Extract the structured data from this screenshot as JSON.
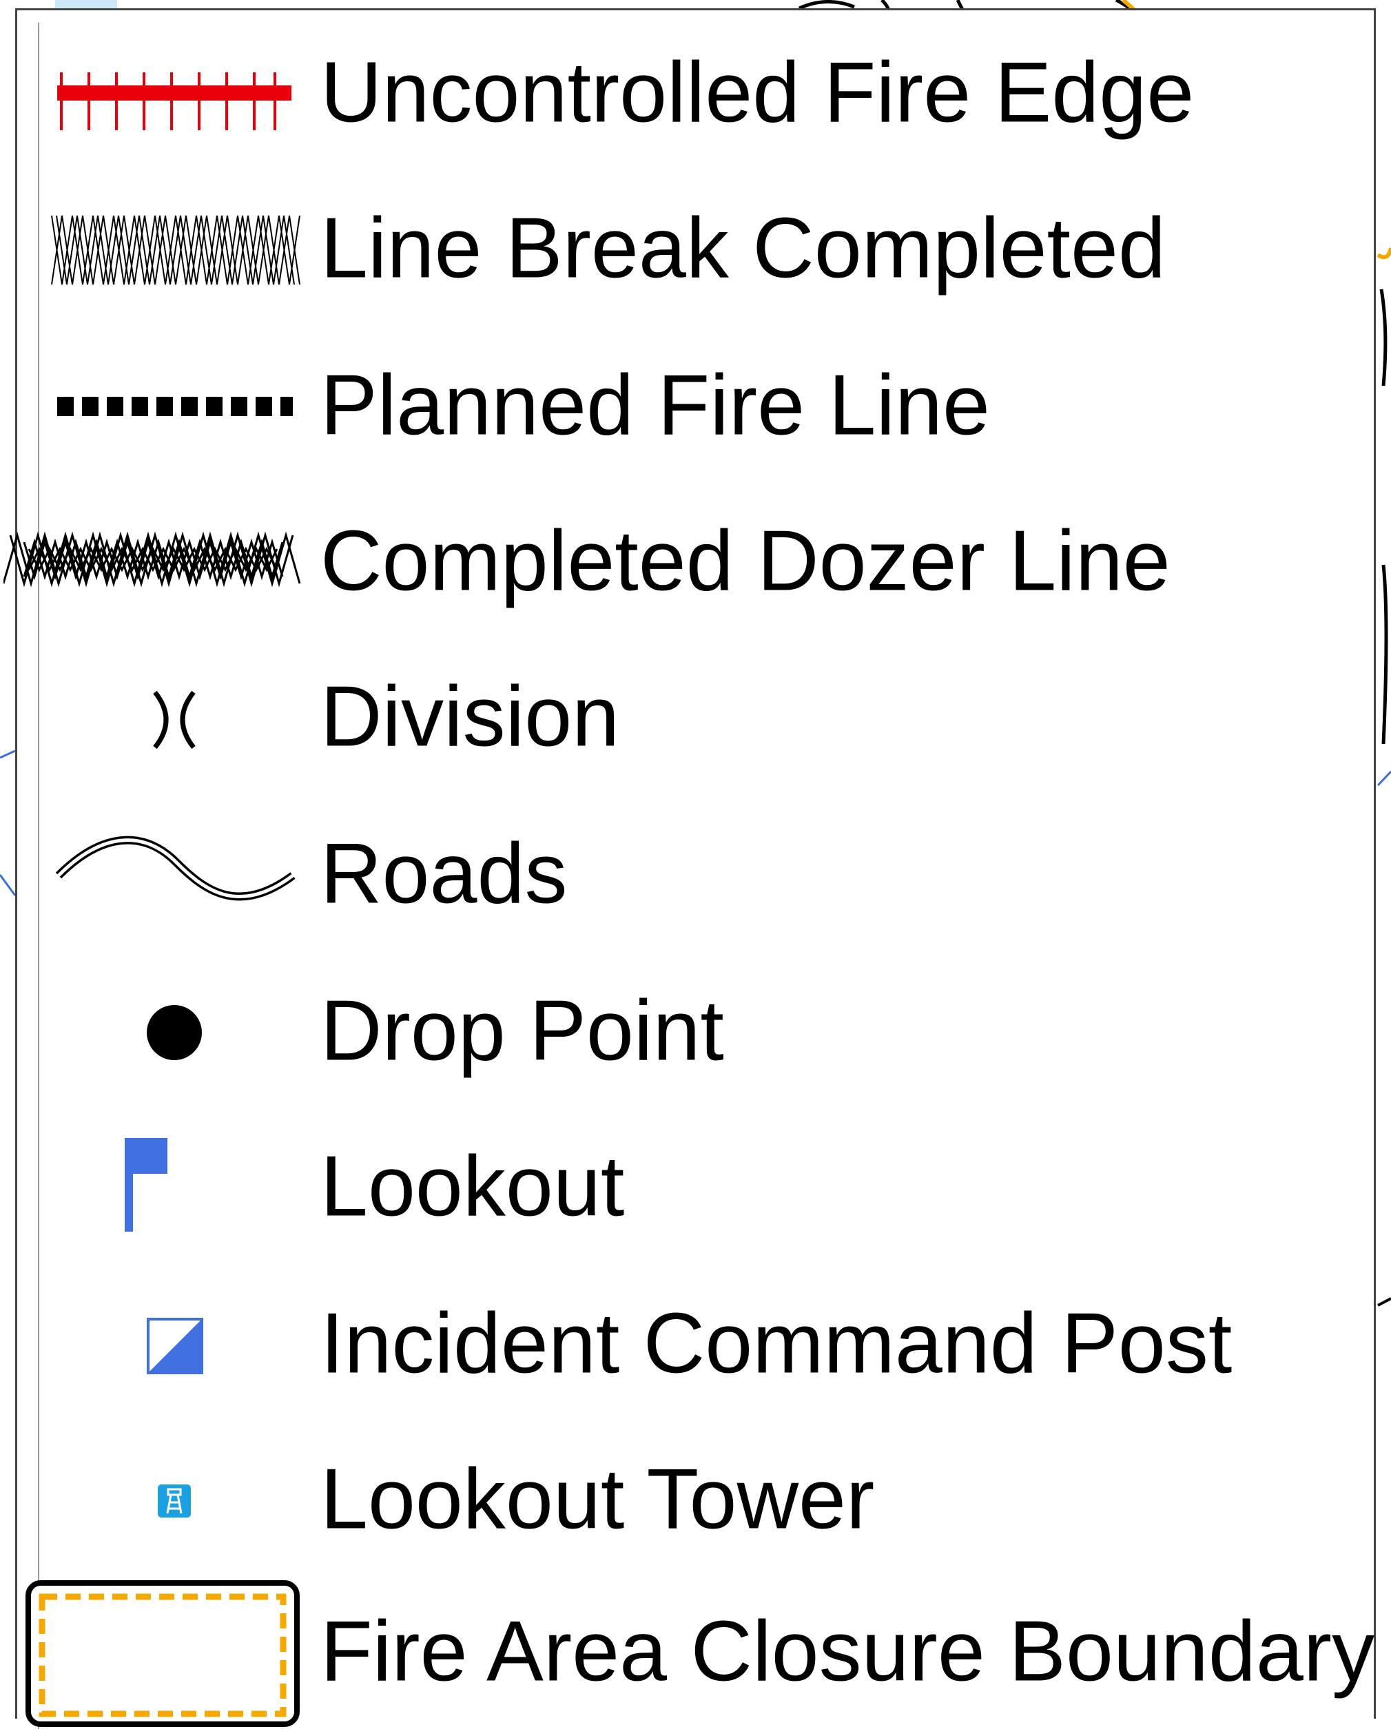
{
  "legend": {
    "items": [
      {
        "key": "uncontrolled",
        "label": "Uncontrolled Fire Edge",
        "icon": "uncontrolled-fire-edge-icon",
        "color": "#e8000b"
      },
      {
        "key": "linebreak",
        "label": "Line Break Completed",
        "icon": "line-break-completed-icon",
        "color": "#000000"
      },
      {
        "key": "planned",
        "label": "Planned Fire Line",
        "icon": "planned-fire-line-icon",
        "color": "#000000"
      },
      {
        "key": "dozer",
        "label": "Completed Dozer Line",
        "icon": "completed-dozer-line-icon",
        "color": "#000000"
      },
      {
        "key": "division",
        "label": "Division",
        "icon": "division-icon",
        "color": "#000000"
      },
      {
        "key": "roads",
        "label": "Roads",
        "icon": "roads-icon",
        "color": "#000000"
      },
      {
        "key": "drop",
        "label": "Drop Point",
        "icon": "drop-point-icon",
        "color": "#000000"
      },
      {
        "key": "lookout",
        "label": "Lookout",
        "icon": "lookout-flag-icon",
        "color": "#4070e0"
      },
      {
        "key": "icp",
        "label": "Incident Command Post",
        "icon": "incident-command-post-icon",
        "color": "#4070e0"
      },
      {
        "key": "tower",
        "label": "Lookout Tower",
        "icon": "lookout-tower-icon",
        "color": "#1ba1e2"
      },
      {
        "key": "closure",
        "label": "Fire Area Closure Boundary",
        "icon": "fire-area-closure-boundary-icon",
        "color": "#f5a800"
      }
    ]
  }
}
